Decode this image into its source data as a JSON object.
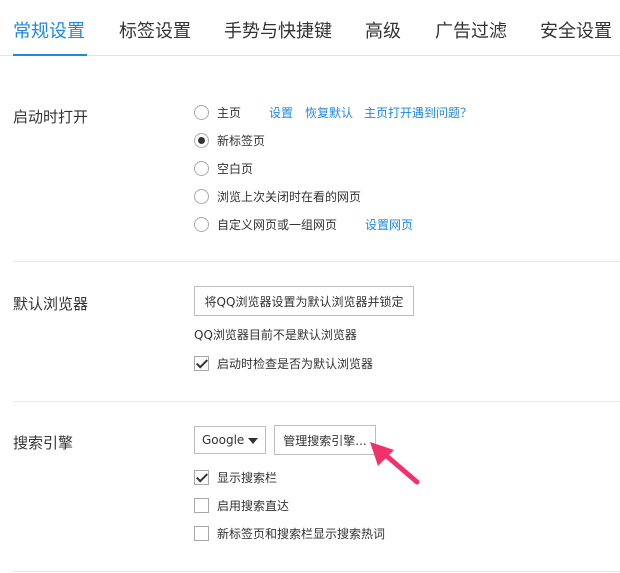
{
  "tabs": [
    {
      "label": "常规设置",
      "active": true
    },
    {
      "label": "标签设置"
    },
    {
      "label": "手势与快捷键"
    },
    {
      "label": "高级"
    },
    {
      "label": "广告过滤"
    },
    {
      "label": "安全设置"
    }
  ],
  "startup": {
    "title": "启动时打开",
    "options": [
      {
        "label": "主页",
        "checked": false
      },
      {
        "label": "新标签页",
        "checked": true
      },
      {
        "label": "空白页",
        "checked": false
      },
      {
        "label": "浏览上次关闭时在看的网页",
        "checked": false
      },
      {
        "label": "自定义网页或一组网页",
        "checked": false
      }
    ],
    "links": {
      "settings": "设置",
      "restore_default": "恢复默认",
      "homepage_problem": "主页打开遇到问题？",
      "set_pages": "设置网页"
    }
  },
  "default_browser": {
    "title": "默认浏览器",
    "set_button": "将QQ浏览器设置为默认浏览器并锁定",
    "status": "QQ浏览器目前不是默认浏览器",
    "check_label": "启动时检查是否为默认浏览器",
    "check_checked": true
  },
  "search": {
    "title": "搜索引擎",
    "engine_selected": "Google",
    "manage_button": "管理搜索引擎...",
    "checks": [
      {
        "label": "显示搜索栏",
        "checked": true
      },
      {
        "label": "启用搜索直达",
        "checked": false
      },
      {
        "label": "新标签页和搜索栏显示搜索热词",
        "checked": false
      }
    ]
  },
  "colors": {
    "accent": "#1e88e5",
    "annotation_arrow": "#f0326c"
  }
}
